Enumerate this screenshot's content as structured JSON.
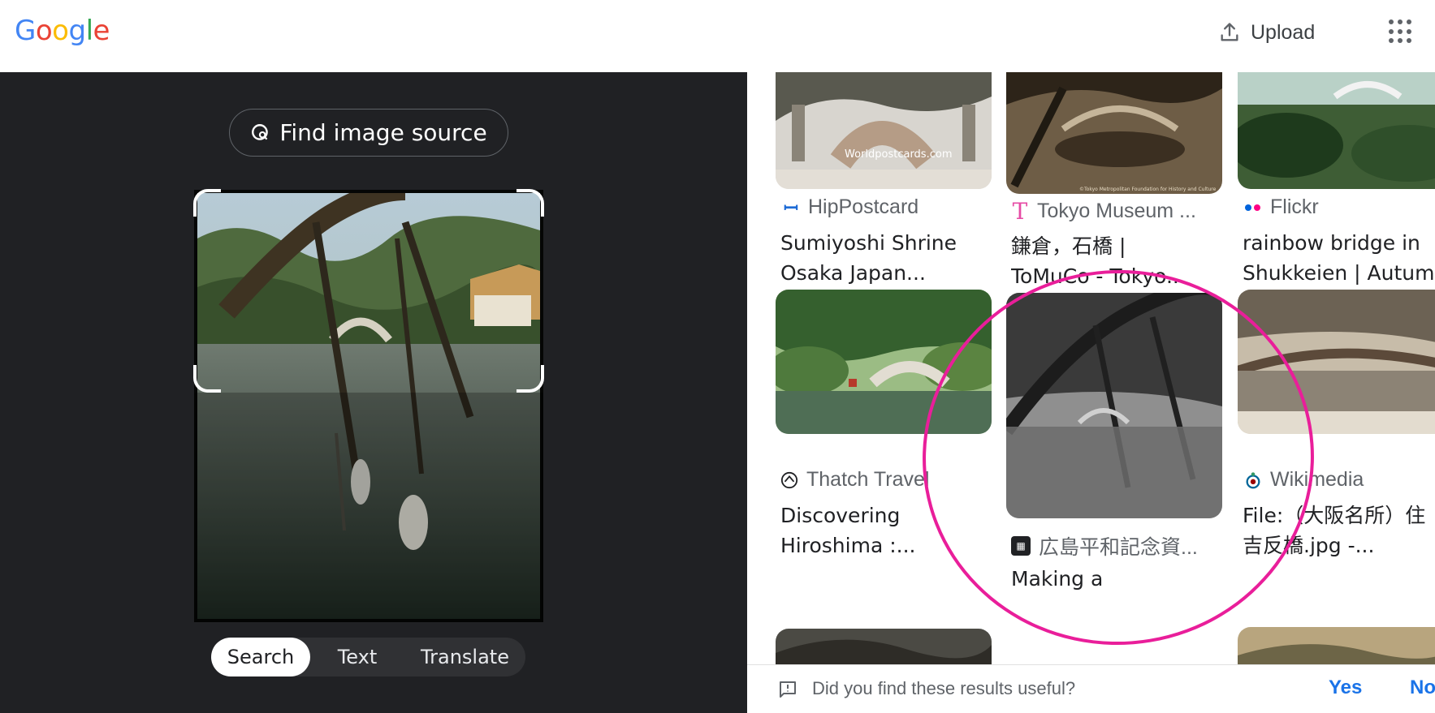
{
  "header": {
    "logo_text": "Google",
    "upload_label": "Upload"
  },
  "left_panel": {
    "find_source_label": "Find image source",
    "modes": [
      {
        "label": "Search",
        "active": true
      },
      {
        "label": "Text",
        "active": false
      },
      {
        "label": "Translate",
        "active": false
      }
    ]
  },
  "results": [
    {
      "source": "HipPostcard",
      "title_line1": "Sumiyoshi Shrine",
      "title_line2": "Osaka Japan..."
    },
    {
      "source": "Tokyo Museum ...",
      "title_line1": "鎌倉，石橋 |",
      "title_line2": "ToMuCo - Tokyo..."
    },
    {
      "source": "Flickr",
      "title_line1": "rainbow bridge in",
      "title_line2": "Shukkeien | Autum..."
    },
    {
      "source": "Thatch Travel",
      "title_line1": "Discovering",
      "title_line2": "Hiroshima :..."
    },
    {
      "source": "広島平和記念資...",
      "title_line1": "Making a",
      "title_line2": ""
    },
    {
      "source": "Wikimedia",
      "title_line1": "File:（大阪名所）住",
      "title_line2": "吉反橋.jpg -..."
    }
  ],
  "thumb_captions": {
    "card1_watermark": "Worldpostcards.com",
    "card2_watermark": "©Tokyo Metropolitan Foundation for History and Culture"
  },
  "feedback": {
    "question": "Did you find these results useful?",
    "yes": "Yes",
    "no": "No"
  },
  "colors": {
    "dark_panel": "#202124",
    "annotation_ring": "#e91e9a",
    "link_blue": "#1a73e8"
  }
}
